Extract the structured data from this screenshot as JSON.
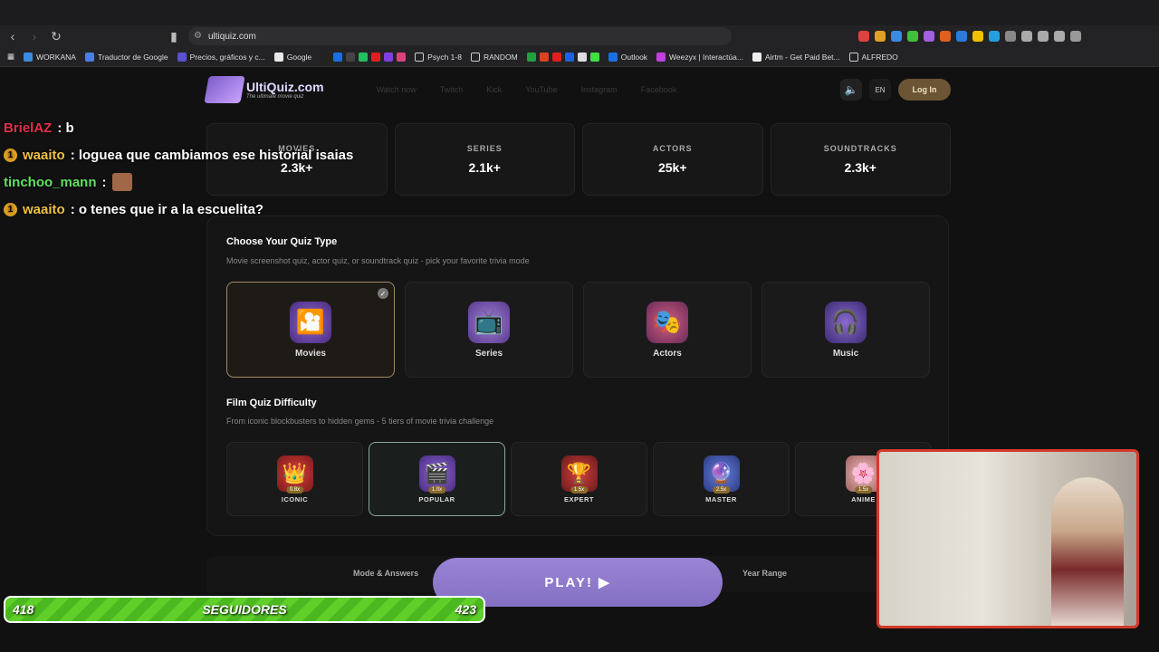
{
  "browser": {
    "url": "ultiquiz.com",
    "bookmarks": [
      "WORKANA",
      "Traductor de Google",
      "Precios, gráficos y c...",
      "Google",
      "Psych 1-8",
      "RANDOM",
      "Outlook",
      "Weezyx | Interactúa...",
      "Airtm - Get Paid Bet...",
      "ALFREDO"
    ]
  },
  "header": {
    "logo": "UltiQuiz.com",
    "tagline": "The ultimate movie quiz",
    "links": [
      "Watch now",
      "Twitch",
      "Kick",
      "YouTube",
      "Instagram",
      "Facebook"
    ],
    "lang": "EN",
    "login": "Log In"
  },
  "stats": [
    {
      "label": "MOVIES",
      "value": "2.3k+"
    },
    {
      "label": "SERIES",
      "value": "2.1k+"
    },
    {
      "label": "ACTORS",
      "value": "25k+"
    },
    {
      "label": "SOUNDTRACKS",
      "value": "2.3k+"
    }
  ],
  "quiz_type": {
    "title": "Choose Your Quiz Type",
    "subtitle": "Movie screenshot quiz, actor quiz, or soundtrack quiz - pick your favorite trivia mode",
    "options": [
      {
        "label": "Movies",
        "icon": "film-reel-icon",
        "selected": true
      },
      {
        "label": "Series",
        "icon": "tv-icon",
        "selected": false
      },
      {
        "label": "Actors",
        "icon": "theater-masks-icon",
        "selected": false
      },
      {
        "label": "Music",
        "icon": "headphones-icon",
        "selected": false
      }
    ]
  },
  "difficulty": {
    "title": "Film Quiz Difficulty",
    "subtitle": "From iconic blockbusters to hidden gems - 5 tiers of movie trivia challenge",
    "options": [
      {
        "label": "ICONIC",
        "mult": "0.8x",
        "selected": false
      },
      {
        "label": "POPULAR",
        "mult": "1.0x",
        "selected": true
      },
      {
        "label": "EXPERT",
        "mult": "1.5x",
        "selected": false
      },
      {
        "label": "MASTER",
        "mult": "2.5x",
        "selected": false
      },
      {
        "label": "ANIME",
        "mult": "1.5x",
        "selected": false
      }
    ]
  },
  "bottom": {
    "mode": "Mode & Answers",
    "year": "Year Range",
    "play": "PLAY! ▶"
  },
  "chat": [
    {
      "user": "BrielAZ",
      "color": "#e0304a",
      "badge": false,
      "msg": ": b"
    },
    {
      "user": "waaito",
      "color": "#f0c040",
      "badge": true,
      "msg": ": loguea que cambiamos ese historial isaias"
    },
    {
      "user": "tinchoo_mann",
      "color": "#5fe05f",
      "badge": false,
      "msg": ":",
      "emote": true
    },
    {
      "user": "waaito",
      "color": "#f0c040",
      "badge": true,
      "msg": ": o tenes que ir a la escuelita?"
    }
  ],
  "followers": {
    "current": "418",
    "label": "SEGUIDORES",
    "goal": "423"
  },
  "colors": {
    "accent": "#8a76c8",
    "gold": "#9c8a64"
  }
}
